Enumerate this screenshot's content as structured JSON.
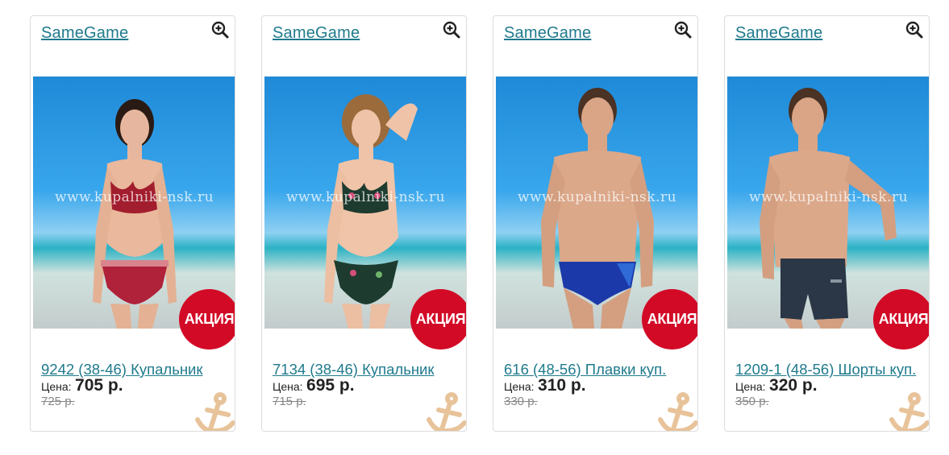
{
  "products": [
    {
      "brand": "SameGame",
      "title": "9242 (38-46) Купальник",
      "price_label": "Цена:",
      "price": "705 р.",
      "old_price": "725 р.",
      "badge": "АКЦИЯ",
      "watermark": "www.kupalniki-nsk.ru"
    },
    {
      "brand": "SameGame",
      "title": "7134 (38-46) Купальник",
      "price_label": "Цена:",
      "price": "695 р.",
      "old_price": "715 р.",
      "badge": "АКЦИЯ",
      "watermark": "www.kupalniki-nsk.ru"
    },
    {
      "brand": "SameGame",
      "title": "616 (48-56) Плавки куп.",
      "price_label": "Цена:",
      "price": "310 р.",
      "old_price": "330 р.",
      "badge": "АКЦИЯ",
      "watermark": "www.kupalniki-nsk.ru"
    },
    {
      "brand": "SameGame",
      "title": "1209-1 (48-56) Шорты куп.",
      "price_label": "Цена:",
      "price": "320 р.",
      "old_price": "350 р.",
      "badge": "АКЦИЯ",
      "watermark": "www.kupalniki-nsk.ru"
    }
  ],
  "icons": {
    "zoom": "zoom-in-icon",
    "anchor": "anchor-icon"
  },
  "colors": {
    "link": "#1f7a8c",
    "badge": "#d20a26",
    "anchor": "#e8c39a"
  }
}
